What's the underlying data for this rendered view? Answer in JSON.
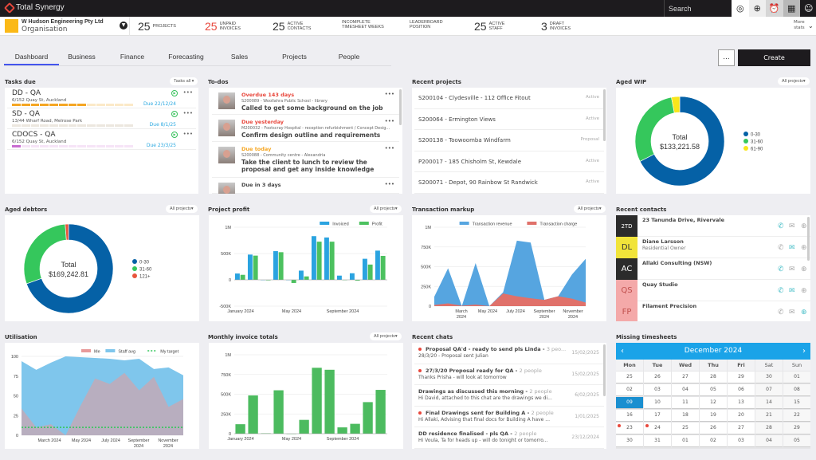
{
  "app": {
    "title": "Total Synergy",
    "search_placeholder": "Search"
  },
  "topbar_icons": [
    "brain-icon",
    "add-circle-icon",
    "alarm-clock-icon",
    "calendar-icon",
    "user-circle-icon"
  ],
  "org": {
    "name": "W Hudson Engineering Pty Ltd",
    "sub": "Organisation",
    "color": "#fbb917"
  },
  "stats": [
    {
      "n": "25",
      "l1": "Projects",
      "l2": "",
      "red": false
    },
    {
      "n": "25",
      "l1": "Unpaid",
      "l2": "Invoices",
      "red": true
    },
    {
      "n": "25",
      "l1": "Active",
      "l2": "Contacts",
      "red": false
    },
    {
      "n": "",
      "l1": "Incomplete",
      "l2": "Timesheet weeks",
      "red": false
    },
    {
      "n": "",
      "l1": "Leaderboard",
      "l2": "Position",
      "red": false
    },
    {
      "n": "25",
      "l1": "Active",
      "l2": "Staff",
      "red": false
    },
    {
      "n": "3",
      "l1": "Draft",
      "l2": "Invoices",
      "red": false
    }
  ],
  "more_stats": {
    "l1": "More",
    "l2": "stats"
  },
  "tabs": [
    "Dashboard",
    "Business",
    "Finance",
    "Forecasting",
    "Sales",
    "Projects",
    "People"
  ],
  "active_tab": "Dashboard",
  "actions": {
    "more": "...",
    "create": "Create"
  },
  "tasks": {
    "title": "Tasks due",
    "filter": "Tasks all ▾",
    "items": [
      {
        "title": "DD - QA",
        "address": "6/152 Quay St, Auckland",
        "due": "Due 22/12/24",
        "progress": 0.62,
        "color": "#f5a623",
        "track": "#fbe9c8"
      },
      {
        "title": "SD - QA",
        "address": "13/44 Wharf Road, Melrose Park",
        "due": "Due 8/1/25",
        "progress": 0,
        "color": "#c8bfae",
        "track": "#ece7df"
      },
      {
        "title": "CDOCS - QA",
        "address": "6/152 Quay St, Auckland",
        "due": "Due 23/3/25",
        "progress": 0.09,
        "color": "#c86dd0",
        "track": "#f6e4f7"
      }
    ]
  },
  "todos": {
    "title": "To-dos",
    "items": [
      {
        "status": "Overdue 143 days",
        "status_color": "#e8473c",
        "sub": "S200089 - Woollahra Public School - library",
        "msg": "Called to get some background on the job"
      },
      {
        "status": "Due yesterday",
        "status_color": "#e8473c",
        "sub": "M200032 - Footscray Hospital - reception refurbishment / Concept Desig...",
        "msg": "Confirm design outline and requirements"
      },
      {
        "status": "Due today",
        "status_color": "#f5a623",
        "sub": "S200088 - Community centre - Alexandria",
        "msg": "Take the client to lunch to review the proposal and get any inside knowledge"
      },
      {
        "status": "Due in 3 days",
        "status_color": "#444444",
        "sub": "",
        "msg": ""
      }
    ]
  },
  "recent_projects": {
    "title": "Recent projects",
    "items": [
      {
        "name": "S200104 - Clydesville - 112 Office Fitout",
        "status": "Active"
      },
      {
        "name": "S200064 - Ermington Views",
        "status": "Active"
      },
      {
        "name": "S200138 - Toowoomba Windfarm",
        "status": "Proposal"
      },
      {
        "name": "P200017 - 185 Chisholm St, Kewdale",
        "status": "Active"
      },
      {
        "name": "S200071 - Depot, 90 Rainbow St Randwick",
        "status": "Active"
      }
    ]
  },
  "aged_wip": {
    "title": "Aged WIP",
    "filter": "All projects▾",
    "total_label": "Total",
    "total": "$133,221.58"
  },
  "aged_debtors": {
    "title": "Aged debtors",
    "filter": "All projects▾",
    "total_label": "Total",
    "total": "$169,242.81"
  },
  "project_profit": {
    "title": "Project profit",
    "filter": "All projects▾"
  },
  "transaction_markup": {
    "title": "Transaction markup",
    "filter": "All projects▾"
  },
  "recent_contacts": {
    "title": "Recent contacts",
    "items": [
      {
        "initials": "2TD",
        "bg": "#2b2b2b",
        "fg": "#ffffff",
        "name": "23 Tanunda Drive, Rivervale",
        "sub": "",
        "active": "phone"
      },
      {
        "initials": "DL",
        "bg": "#f1e43a",
        "fg": "#333333",
        "name": "Diane Larsson",
        "sub": "Residential Owner",
        "active": "mail"
      },
      {
        "initials": "AC",
        "bg": "#2b2b2b",
        "fg": "#ffffff",
        "name": "Allaki Consulting (NSW)",
        "sub": "",
        "active": "phone"
      },
      {
        "initials": "QS",
        "bg": "#f4a9a9",
        "fg": "#c0504d",
        "name": "Quay Studio",
        "sub": "",
        "active": "both"
      },
      {
        "initials": "FP",
        "bg": "#f4a9a9",
        "fg": "#c0504d",
        "name": "Filament Precision",
        "sub": "",
        "active": "web"
      }
    ]
  },
  "utilisation": {
    "title": "Utilisation"
  },
  "monthly_invoice": {
    "title": "Monthly invoice totals",
    "filter": "All projects▾"
  },
  "recent_chats": {
    "title": "Recent chats",
    "items": [
      {
        "unread": true,
        "title": "Proposal QA'd - ready to send pls Linda - ",
        "people": "3 peo...",
        "body": "28/3/20 - Proposal sent Julian",
        "date": "15/02/2025"
      },
      {
        "unread": true,
        "title": "27/3/20 Proposal ready for QA - ",
        "people": "2 people",
        "body": "Thanks Prisha - will look at tomorrow",
        "date": "15/02/2025"
      },
      {
        "unread": false,
        "title": "Drawings as discussed this morning - ",
        "people": "2 people",
        "body": "Hi David, attached to this chat are the drawings we di...",
        "date": "6/02/2025"
      },
      {
        "unread": true,
        "title": "Final Drawings sent for Building A - ",
        "people": "2 people",
        "body": "Hi Allaki, Advising that final docs for Building A have ...",
        "date": "1/01/2025"
      },
      {
        "unread": false,
        "title": "DD residence finalised - pls QA - ",
        "people": "2 people",
        "body": "Hi Voula, Ta for heads up - will do tonight or tomorro...",
        "date": "23/12/2024"
      }
    ]
  },
  "missing_timesheets": {
    "title": "Missing timesheets",
    "month": "December 2024",
    "dow": [
      "Mon",
      "Tue",
      "Wed",
      "Thu",
      "Fri",
      "Sat",
      "Sun"
    ],
    "weeks": [
      [
        "25",
        "26",
        "27",
        "28",
        "29",
        "30",
        "01"
      ],
      [
        "02",
        "03",
        "04",
        "05",
        "06",
        "07",
        "08"
      ],
      [
        "09",
        "10",
        "11",
        "12",
        "13",
        "14",
        "15"
      ],
      [
        "16",
        "17",
        "18",
        "19",
        "20",
        "21",
        "22"
      ],
      [
        "23",
        "24",
        "25",
        "26",
        "27",
        "28",
        "29"
      ],
      [
        "30",
        "31",
        "01",
        "02",
        "03",
        "04",
        "05"
      ]
    ],
    "selected": "09",
    "missing": [
      "23",
      "24"
    ]
  },
  "chart_data": [
    {
      "id": "aged_wip",
      "type": "pie",
      "title": "Aged WIP",
      "categories": [
        "0-30",
        "31-60",
        "61-90"
      ],
      "values": [
        67.5,
        29.5,
        3.0
      ],
      "colors": [
        "#0561a6",
        "#35c75c",
        "#f8e61b"
      ],
      "center_text": [
        "Total",
        "$133,221.58"
      ],
      "legend": "right"
    },
    {
      "id": "aged_debtors",
      "type": "pie",
      "title": "Aged debtors",
      "categories": [
        "0-30",
        "31-60",
        "121+"
      ],
      "values": [
        69.5,
        29.3,
        1.2
      ],
      "colors": [
        "#0561a6",
        "#35c75c",
        "#e8553c"
      ],
      "center_text": [
        "Total",
        "$169,242.81"
      ],
      "legend": "right"
    },
    {
      "id": "project_profit",
      "type": "bar",
      "title": "Project profit",
      "categories": [
        "Jan 2024",
        "Feb 2024",
        "Mar 2024",
        "Apr 2024",
        "May 2024",
        "Jun 2024",
        "Jul 2024",
        "Aug 2024",
        "Sep 2024",
        "Oct 2024",
        "Nov 2024",
        "Dec 2024"
      ],
      "series": [
        {
          "name": "Invoiced",
          "color": "#2aa3e0",
          "values": [
            120000,
            480000,
            0,
            545000,
            0,
            175000,
            830000,
            805000,
            80000,
            125000,
            400000,
            555000
          ]
        },
        {
          "name": "Profit",
          "color": "#4cc15f",
          "values": [
            95000,
            460000,
            -10000,
            525000,
            -60000,
            65000,
            725000,
            725000,
            0,
            -15000,
            290000,
            455000
          ]
        }
      ],
      "yticks": [
        "1M",
        "500K",
        "0",
        "-500K"
      ],
      "ylim": [
        -500000,
        1000000
      ],
      "xticks": [
        "January 2024",
        "May 2024",
        "September 2024"
      ],
      "legend": "top-right",
      "grid": true
    },
    {
      "id": "transaction_markup",
      "type": "area",
      "title": "Transaction markup",
      "categories": [
        "Jan 2024",
        "Feb 2024",
        "Mar 2024",
        "Apr 2024",
        "May 2024",
        "Jun 2024",
        "Jul 2024",
        "Aug 2024",
        "Sep 2024",
        "Oct 2024",
        "Nov 2024",
        "Dec 2024"
      ],
      "series": [
        {
          "name": "Transaction revenue",
          "color": "#56a5e0",
          "values": [
            120000,
            480000,
            0,
            545000,
            0,
            175000,
            830000,
            805000,
            80000,
            125000,
            400000,
            600000
          ]
        },
        {
          "name": "Transaction charge",
          "color": "#e0716a",
          "values": [
            15000,
            35000,
            5000,
            20000,
            0,
            160000,
            125000,
            100000,
            80000,
            125000,
            95000,
            45000
          ]
        }
      ],
      "yticks": [
        "1M",
        "750K",
        "500K",
        "250K",
        "0"
      ],
      "ylim": [
        0,
        1000000
      ],
      "xticks": [
        "March 2024",
        "May 2024",
        "July 2024",
        "September 2024",
        "November 2024"
      ],
      "legend": "top-right",
      "grid": true
    },
    {
      "id": "utilisation",
      "type": "area",
      "title": "Utilisation",
      "categories": [
        "Jan 2024",
        "Feb 2024",
        "Mar 2024",
        "Apr 2024",
        "May 2024",
        "Jun 2024",
        "Jul 2024",
        "Aug 2024",
        "Sep 2024",
        "Oct 2024",
        "Nov 2024",
        "Dec 2024"
      ],
      "series": [
        {
          "name": "Me",
          "color": "#e89a9a",
          "values": [
            34,
            10,
            14,
            0,
            37,
            72,
            65,
            79,
            57,
            74,
            36,
            46
          ]
        },
        {
          "name": "Staff avg",
          "color": "#7fc6ec",
          "values": [
            94,
            83,
            92,
            100,
            99,
            98,
            97,
            95,
            97,
            84,
            86,
            76
          ]
        },
        {
          "name": "My target",
          "color": "#35c75c",
          "values": [
            10,
            10,
            10,
            10,
            10,
            10,
            10,
            10,
            10,
            10,
            10,
            10
          ]
        }
      ],
      "yticks": [
        "100",
        "75",
        "50",
        "25",
        "0"
      ],
      "ylim": [
        0,
        100
      ],
      "xticks": [
        "March 2024",
        "May 2024",
        "July 2024",
        "September 2024",
        "November 2024"
      ],
      "legend": "top-right",
      "grid": true
    },
    {
      "id": "monthly_invoice",
      "type": "bar",
      "title": "Monthly invoice totals",
      "categories": [
        "Jan 2024",
        "Feb 2024",
        "Mar 2024",
        "Apr 2024",
        "May 2024",
        "Jun 2024",
        "Jul 2024",
        "Aug 2024",
        "Sep 2024",
        "Oct 2024",
        "Nov 2024",
        "Dec 2024"
      ],
      "series": [
        {
          "name": "Invoiced",
          "color": "#4cbb5f",
          "values": [
            120000,
            485000,
            5000,
            550000,
            0,
            175000,
            835000,
            810000,
            80000,
            125000,
            400000,
            555000
          ]
        }
      ],
      "yticks": [
        "1M",
        "750K",
        "500K",
        "250K",
        "0"
      ],
      "ylim": [
        0,
        1000000
      ],
      "xticks": [
        "January 2024",
        "May 2024",
        "September 2024"
      ],
      "legend": "none",
      "grid": true
    }
  ]
}
